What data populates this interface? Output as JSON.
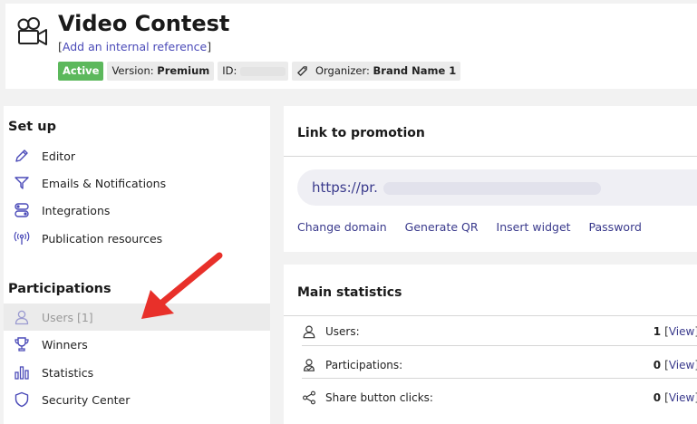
{
  "header": {
    "title": "Video Contest",
    "ref_open": "[",
    "ref_link": "Add an internal reference",
    "ref_close": "]",
    "status": "Active",
    "version_label": "Version:",
    "version_value": "Premium",
    "id_label": "ID:",
    "organizer_label": "Organizer:",
    "organizer_value": "Brand Name 1",
    "icon": "video-camera-icon"
  },
  "sidebar": {
    "setup_title": "Set up",
    "setup_items": [
      {
        "label": "Editor",
        "icon": "pencil-icon"
      },
      {
        "label": "Emails & Notifications",
        "icon": "send-icon"
      },
      {
        "label": "Integrations",
        "icon": "toggles-icon"
      },
      {
        "label": "Publication resources",
        "icon": "broadcast-icon"
      }
    ],
    "participations_title": "Participations",
    "participation_items": [
      {
        "label": "Users [1]",
        "icon": "user-icon"
      },
      {
        "label": "Winners",
        "icon": "trophy-icon"
      },
      {
        "label": "Statistics",
        "icon": "bar-chart-icon"
      },
      {
        "label": "Security Center",
        "icon": "shield-icon"
      }
    ]
  },
  "promotion": {
    "title": "Link to promotion",
    "url": "https://pr.",
    "links": [
      "Change domain",
      "Generate QR",
      "Insert widget",
      "Password"
    ]
  },
  "statistics": {
    "title": "Main statistics",
    "view_open": "[",
    "view_label": "View",
    "view_close": "]",
    "rows": [
      {
        "label": "Users:",
        "value": "1",
        "icon": "user-icon"
      },
      {
        "label": "Participations:",
        "value": "0",
        "icon": "participations-icon"
      },
      {
        "label": "Share button clicks:",
        "value": "0",
        "icon": "share-icon"
      }
    ]
  },
  "colors": {
    "active_badge": "#5cb85c",
    "link": "#3a3a8c",
    "selected_bg": "#ebebeb",
    "arrow": "#e8302a"
  }
}
